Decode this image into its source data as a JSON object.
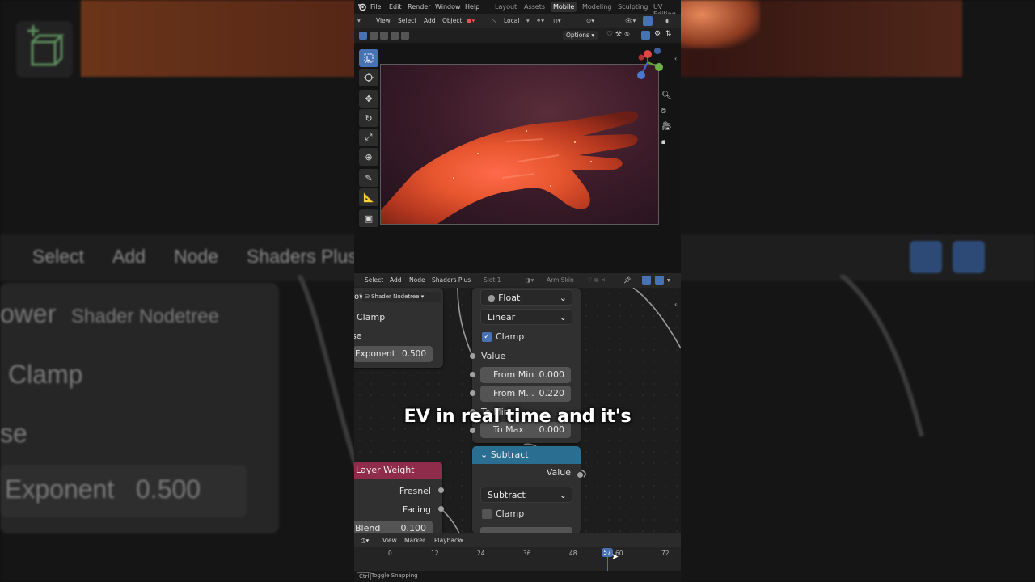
{
  "background_echo": {
    "menu": [
      "Select",
      "Add",
      "Node",
      "Shaders Plus"
    ],
    "node_title": "Shader Nodetree",
    "partial_title": "ower",
    "clamp": "Clamp",
    "se": "se",
    "exponent_label": "Exponent",
    "exponent_value": "0.500"
  },
  "topbar": {
    "menu": [
      "File",
      "Edit",
      "Render",
      "Window",
      "Help"
    ],
    "workspaces": [
      "Layout",
      "Assets",
      "Mobile",
      "Modeling",
      "Sculpting",
      "UV Editing"
    ],
    "active_workspace": "Mobile"
  },
  "viewport_header": {
    "menu": [
      "View",
      "Select",
      "Add",
      "Object"
    ],
    "orientation": "Local",
    "options": "Options"
  },
  "node_header": {
    "menu": [
      "Select",
      "Add",
      "Node",
      "Shaders Plus"
    ],
    "slot": "Slot 1",
    "material": "Arm Skin",
    "tree_label": "Shader Nodetree"
  },
  "map_range_node": {
    "data_type": "Float",
    "interpolation": "Linear",
    "clamp_label": "Clamp",
    "value_label": "Value",
    "from_min_label": "From Min",
    "from_min_value": "0.000",
    "from_max_label": "From M...",
    "from_max_value": "0.220",
    "to_min_label": "To Min",
    "to_max_label": "To Max",
    "to_max_value": "0.000"
  },
  "power_node": {
    "partial_title": "ower",
    "clamp_label": "Clamp",
    "se_label": "se",
    "exponent_label": "Exponent",
    "exponent_value": "0.500"
  },
  "subtract_node": {
    "title": "Subtract",
    "output_label": "Value",
    "operation": "Subtract",
    "clamp_label": "Clamp"
  },
  "layer_weight_node": {
    "title": "Layer Weight",
    "fresnel_label": "Fresnel",
    "facing_label": "Facing",
    "blend_label": "Blend",
    "blend_value": "0.100"
  },
  "timeline": {
    "menu": [
      "View",
      "Marker",
      "Playback"
    ],
    "ticks": [
      "0",
      "12",
      "24",
      "36",
      "48",
      "60",
      "72"
    ],
    "current_frame": "57"
  },
  "statusbar": {
    "key": "Ctrl",
    "hint": "Toggle Snapping"
  },
  "caption": "EV in real time and it's",
  "colors": {
    "accent_blue": "#4772b3",
    "math_node_header": "#2a6f92",
    "input_node_header": "#8f2b4b"
  }
}
